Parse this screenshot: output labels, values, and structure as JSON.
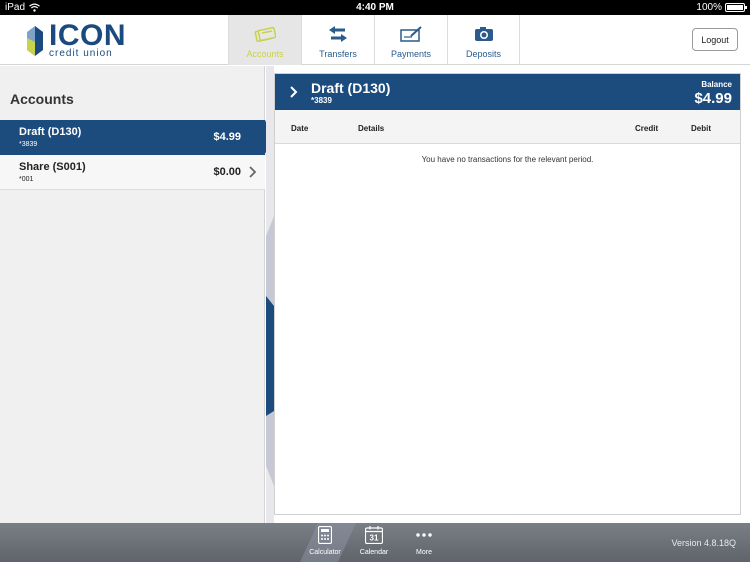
{
  "status_bar": {
    "device": "iPad",
    "time": "4:40 PM",
    "battery": "100%"
  },
  "brand": {
    "word": "ICON",
    "sub": "credit union"
  },
  "nav": {
    "tabs": [
      {
        "label": "Accounts",
        "icon": "accounts-icon",
        "active": true
      },
      {
        "label": "Transfers",
        "icon": "transfer-arrows-icon"
      },
      {
        "label": "Payments",
        "icon": "cheque-icon"
      },
      {
        "label": "Deposits",
        "icon": "camera-icon"
      }
    ]
  },
  "logout_label": "Logout",
  "accounts": {
    "title": "Accounts",
    "items": [
      {
        "name": "Draft (D130)",
        "number": "*3839",
        "amount": "$4.99",
        "selected": true
      },
      {
        "name": "Share (S001)",
        "number": "*001",
        "amount": "$0.00"
      }
    ]
  },
  "detail": {
    "title": "Draft (D130)",
    "number": "*3839",
    "balance_label": "Balance",
    "balance": "$4.99",
    "columns": {
      "date": "Date",
      "details": "Details",
      "credit": "Credit",
      "debit": "Debit"
    },
    "empty_message": "You have no transactions for the relevant period."
  },
  "toolbar": {
    "items": [
      {
        "label": "Calculator",
        "icon": "calculator-icon"
      },
      {
        "label": "Calendar",
        "icon": "calendar-icon",
        "badge": "31"
      },
      {
        "label": "More",
        "icon": "more-icon"
      }
    ]
  },
  "version": "Version 4.8.18Q",
  "colors": {
    "brand_blue": "#1c4b7e",
    "accent_green": "#c8d24a",
    "toolbar_gray": "#6b7076"
  }
}
